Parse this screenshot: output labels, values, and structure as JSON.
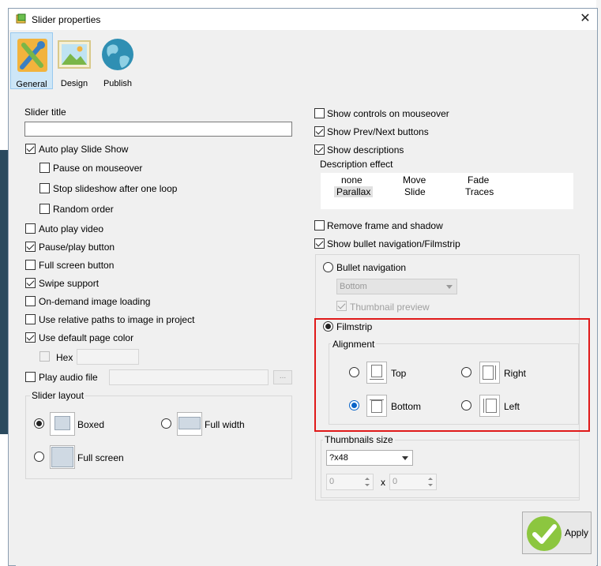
{
  "window": {
    "title": "Slider properties",
    "close_glyph": "✕"
  },
  "tabs": [
    {
      "label": "General",
      "icon": "wrench-screwdriver-icon",
      "active": true
    },
    {
      "label": "Design",
      "icon": "picture-icon",
      "active": false
    },
    {
      "label": "Publish",
      "icon": "globe-icon",
      "active": false
    }
  ],
  "left": {
    "slider_title_label": "Slider title",
    "slider_title_value": "",
    "auto_play": {
      "label": "Auto play Slide Show",
      "checked": true
    },
    "pause_on_mouseover": {
      "label": "Pause on mouseover",
      "checked": false
    },
    "stop_after_loop": {
      "label": "Stop slideshow after one loop",
      "checked": false
    },
    "random_order": {
      "label": "Random order",
      "checked": false
    },
    "auto_play_video": {
      "label": "Auto play video",
      "checked": false
    },
    "pause_play_button": {
      "label": "Pause/play button",
      "checked": true
    },
    "full_screen_button": {
      "label": "Full screen button",
      "checked": false
    },
    "swipe_support": {
      "label": "Swipe support",
      "checked": true
    },
    "on_demand_loading": {
      "label": "On-demand image loading",
      "checked": false
    },
    "relative_paths": {
      "label": "Use relative paths to image in project",
      "checked": false
    },
    "default_page_color": {
      "label": "Use default page color",
      "checked": true
    },
    "hex_label": "Hex",
    "hex_value": "",
    "play_audio": {
      "label": "Play audio file",
      "checked": false
    },
    "audio_value": "",
    "browse_label": "...",
    "slider_layout": {
      "title": "Slider layout",
      "boxed": "Boxed",
      "full_width": "Full width",
      "full_screen": "Full screen",
      "selected": "Boxed"
    }
  },
  "right": {
    "show_controls_mouseover": {
      "label": "Show controls on mouseover",
      "checked": false
    },
    "show_prev_next": {
      "label": "Show Prev/Next buttons",
      "checked": true
    },
    "show_descriptions": {
      "label": "Show descriptions",
      "checked": true
    },
    "description_effect_label": "Description effect",
    "effects": [
      "none",
      "Move",
      "Fade",
      "Parallax",
      "Slide",
      "Traces"
    ],
    "effect_selected": "Parallax",
    "remove_frame": {
      "label": "Remove frame and shadow",
      "checked": false
    },
    "show_bullet_nav": {
      "label": "Show bullet navigation/Filmstrip",
      "checked": true
    },
    "bullet_navigation": "Bullet navigation",
    "bullet_position": "Bottom",
    "thumbnail_preview": {
      "label": "Thumbnail preview",
      "checked": true
    },
    "filmstrip": "Filmstrip",
    "alignment": {
      "title": "Alignment",
      "top": "Top",
      "right": "Right",
      "bottom": "Bottom",
      "left": "Left",
      "selected": "Bottom"
    },
    "thumbnails_size": {
      "title": "Thumbnails size",
      "value": "?x48",
      "width": "0",
      "x_label": "x",
      "height": "0"
    }
  },
  "apply_label": "Apply",
  "colors": {
    "highlight": "#e01919",
    "tab_active": "#cde6f7",
    "radio_blue": "#0a64c8"
  }
}
